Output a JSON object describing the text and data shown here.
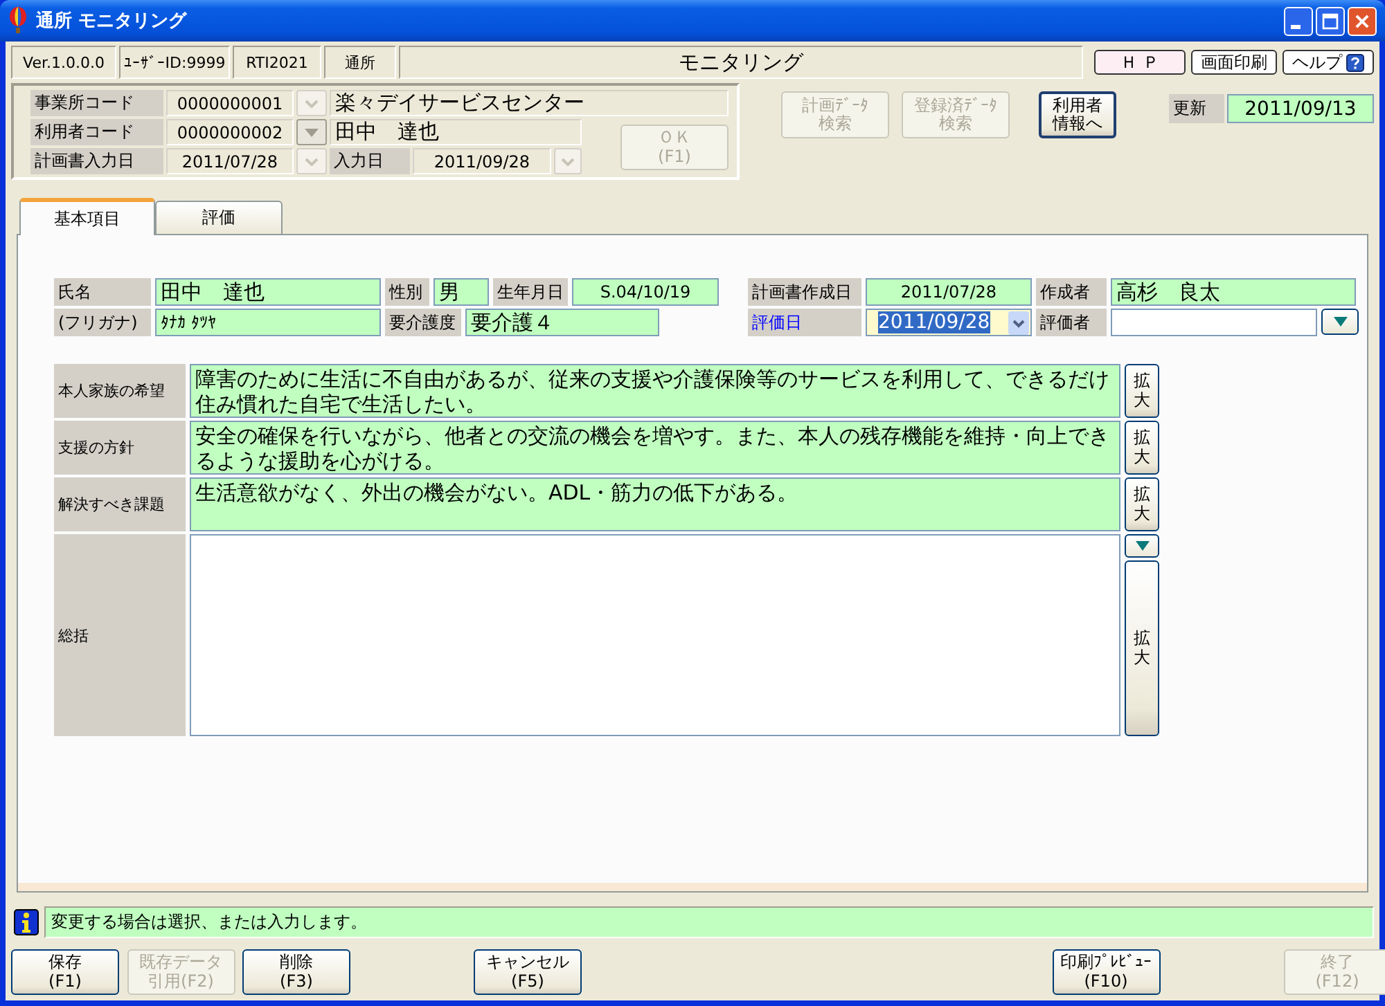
{
  "window": {
    "title": "通所 モニタリング"
  },
  "info_bar": {
    "version": "Ver.1.0.0.0",
    "user_id": "ﾕｰｻﾞｰID:9999",
    "system_code": "RTI2021",
    "service": "通所",
    "screen_title": "モニタリング"
  },
  "top_buttons": [
    {
      "label": "Ｈ Ｐ",
      "kind": "link"
    },
    {
      "label": "画面印刷",
      "kind": "plain"
    },
    {
      "label": "ヘルプ",
      "kind": "help"
    }
  ],
  "header": {
    "office": {
      "label": "事業所コード",
      "code": "0000000001",
      "name": "楽々デイサービスセンター",
      "dropdown_disabled": true
    },
    "user": {
      "label": "利用者コード",
      "code": "0000000002",
      "name": "田中　達也",
      "dropdown_disabled": false
    },
    "plan_input_date": {
      "label": "計画書入力日",
      "value": "2011/07/28",
      "dropdown_disabled": true
    },
    "input_date": {
      "label": "入力日",
      "value": "2011/09/28",
      "dropdown_disabled": true
    },
    "ok_button": {
      "lines": [
        "ＯＫ",
        "(F1)"
      ],
      "disabled": true
    },
    "action_buttons": [
      {
        "lines": [
          "計画ﾃﾞｰﾀ",
          "検索"
        ],
        "disabled": true
      },
      {
        "lines": [
          "登録済ﾃﾞｰﾀ",
          "検索"
        ],
        "disabled": true
      },
      {
        "lines": [
          "利用者",
          "情報へ"
        ],
        "disabled": false
      }
    ],
    "updated": {
      "label": "更新",
      "value": "2011/09/13"
    }
  },
  "tabs": [
    {
      "label": "基本項目",
      "selected": true
    },
    {
      "label": "評価",
      "selected": false
    }
  ],
  "basic": {
    "name": {
      "label": "氏名",
      "value": "田中　達也"
    },
    "gender": {
      "label": "性別",
      "value": "男"
    },
    "birth": {
      "label": "生年月日",
      "value": "S.04/10/19"
    },
    "kana": {
      "label": "(フリガナ)",
      "value": "ﾀﾅｶ ﾀﾂﾔ"
    },
    "care_level": {
      "label": "要介護度",
      "value": "要介護４"
    },
    "plan_date": {
      "label": "計画書作成日",
      "value": "2011/07/28"
    },
    "author": {
      "label": "作成者",
      "value": "高杉　良太"
    },
    "eval_date": {
      "label": "評価日",
      "value": "2011/09/28",
      "required": true,
      "focused": true
    },
    "evaluator": {
      "label": "評価者"
    }
  },
  "notes": [
    {
      "kind": "text",
      "label": "本人家族の希望",
      "text": "障害のために生活に不自由があるが、従来の支援や介護保険等のサービスを利用して、できるだけ住み慣れた自宅で生活したい。",
      "button": "拡大"
    },
    {
      "kind": "text",
      "label": "支援の方針",
      "text": "安全の確保を行いながら、他者との交流の機会を増やす。また、本人の残存機能を維持・向上できるような援助を心がける。",
      "button": "拡大"
    },
    {
      "kind": "text",
      "label": "解決すべき課題",
      "text": "生活意欲がなく、外出の機会がない。ADL・筋力の低下がある。",
      "button": "拡大"
    },
    {
      "kind": "summary",
      "label": "総括",
      "button": "拡大"
    }
  ],
  "status": {
    "message": "変更する場合は選択、または入力します。"
  },
  "bottom_buttons": [
    {
      "lines": [
        "保存",
        "(F1)"
      ],
      "disabled": false
    },
    {
      "lines": [
        "既存データ",
        "引用(F2)"
      ],
      "disabled": true
    },
    {
      "lines": [
        "削除",
        "(F3)"
      ],
      "disabled": false
    },
    {
      "lines": [
        "キャンセル",
        "(F5)"
      ],
      "disabled": false
    },
    {
      "lines": [
        "印刷ﾌﾟﾚﾋﾞｭｰ",
        "(F10)"
      ],
      "disabled": false
    },
    {
      "lines": [
        "終了",
        "(F12)"
      ],
      "disabled": true
    }
  ]
}
